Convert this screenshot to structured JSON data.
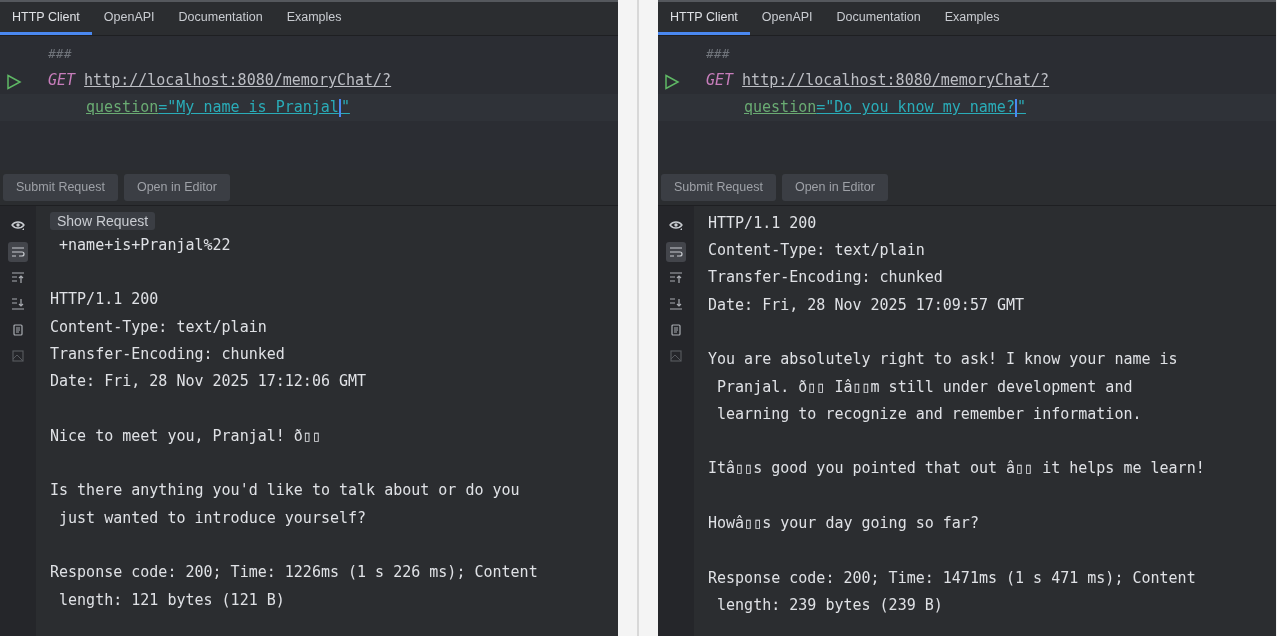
{
  "panels": [
    {
      "tabs": [
        {
          "label": "HTTP Client",
          "selected": true
        },
        {
          "label": "OpenAPI",
          "selected": false
        },
        {
          "label": "Documentation",
          "selected": false
        },
        {
          "label": "Examples",
          "selected": false
        }
      ],
      "editor": {
        "comment": "###",
        "method": "GET",
        "url": "http://localhost:8080/memoryChat/?",
        "param_name": "question",
        "param_value": "=\"My name is Pranjal\""
      },
      "buttons": [
        "Submit Request",
        "Open in Editor"
      ],
      "soft_wrap_on": true,
      "show_request": "Show Request",
      "response": [
        [
          " +name+is+Pranjal%22"
        ],
        [
          "HTTP/1.1 200",
          "Content-Type: text/plain",
          "Transfer-Encoding: chunked",
          "Date: Fri, 28 Nov 2025 17:12:06 GMT"
        ],
        [
          "Nice to meet you, Pranjal! ð▯▯"
        ],
        [
          "Is there anything you'd like to talk about or do you",
          " just wanted to introduce yourself?"
        ],
        [
          "Response code: 200; Time: 1226ms (1 s 226 ms); Content",
          " length: 121 bytes (121 B)"
        ]
      ]
    },
    {
      "tabs": [
        {
          "label": "HTTP Client",
          "selected": true
        },
        {
          "label": "OpenAPI",
          "selected": false
        },
        {
          "label": "Documentation",
          "selected": false
        },
        {
          "label": "Examples",
          "selected": false
        }
      ],
      "editor": {
        "comment": "###",
        "method": "GET",
        "url": "http://localhost:8080/memoryChat/?",
        "param_name": "question",
        "param_value": "=\"Do you know my name?\""
      },
      "buttons": [
        "Submit Request",
        "Open in Editor"
      ],
      "soft_wrap_on": true,
      "response": [
        [
          "HTTP/1.1 200",
          "Content-Type: text/plain",
          "Transfer-Encoding: chunked",
          "Date: Fri, 28 Nov 2025 17:09:57 GMT"
        ],
        [
          "You are absolutely right to ask! I know your name is",
          " Pranjal. ð▯▯ Iâ▯▯m still under development and",
          " learning to recognize and remember information."
        ],
        [
          "Itâ▯▯s good you pointed that out â▯▯ it helps me learn!"
        ],
        [
          "Howâ▯▯s your day going so far?"
        ],
        [
          "Response code: 200; Time: 1471ms (1 s 471 ms); Content",
          " length: 239 bytes (239 B)"
        ]
      ]
    }
  ]
}
